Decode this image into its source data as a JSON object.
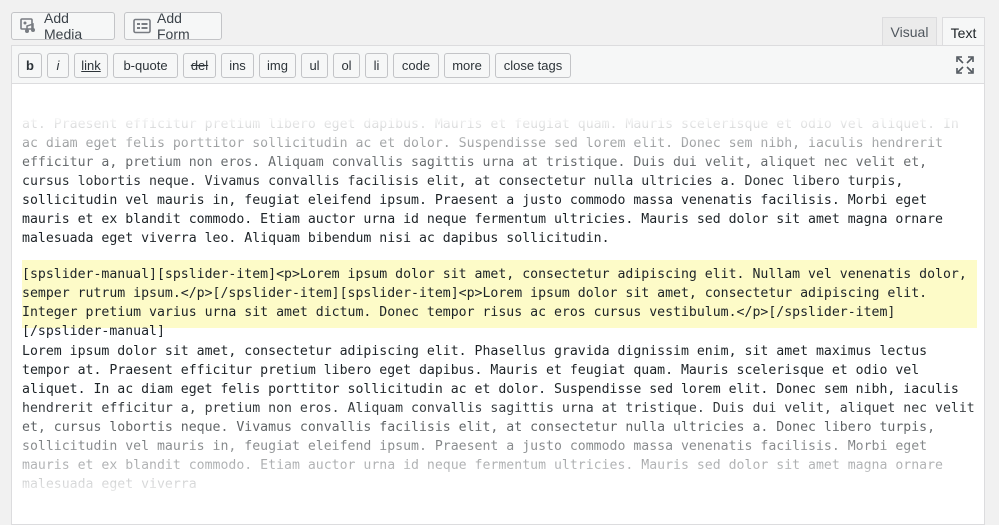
{
  "media_buttons": {
    "add_media": "Add Media",
    "add_form": "Add Form"
  },
  "tabs": {
    "visual": "Visual",
    "text": "Text",
    "active": "Text"
  },
  "quicktags": [
    "b",
    "i",
    "link",
    "b-quote",
    "del",
    "ins",
    "img",
    "ul",
    "ol",
    "li",
    "code",
    "more",
    "close tags"
  ],
  "content": {
    "para1": "at. Praesent efficitur pretium libero eget dapibus. Mauris et feugiat quam. Mauris scelerisque et odio vel aliquet. In ac diam eget felis porttitor sollicitudin ac et dolor. Suspendisse sed lorem elit. Donec sem nibh, iaculis hendrerit efficitur a, pretium non eros. Aliquam convallis sagittis urna at tristique. Duis dui velit, aliquet nec velit et, cursus lobortis neque. Vivamus convallis facilisis elit, at consectetur nulla ultricies a. Donec libero turpis, sollicitudin vel mauris in, feugiat eleifend ipsum. Praesent a justo commodo massa venenatis facilisis. Morbi eget mauris et ex blandit commodo. Etiam auctor urna id neque fermentum ultricies. Mauris sed dolor sit amet magna ornare malesuada eget viverra leo. Aliquam bibendum nisi ac dapibus sollicitudin.",
    "shortcode": "[spslider-manual][spslider-item]<p>Lorem ipsum dolor sit amet, consectetur adipiscing elit. Nullam vel venenatis dolor, semper rutrum ipsum.</p>[/spslider-item][spslider-item]<p>Lorem ipsum dolor sit amet, consectetur adipiscing elit. Integer pretium varius urna sit amet dictum. Donec tempor risus ac eros cursus vestibulum.</p>[/spslider-item][/spslider-manual]",
    "para3": "Lorem ipsum dolor sit amet, consectetur adipiscing elit. Phasellus gravida dignissim enim, sit amet maximus lectus tempor at. Praesent efficitur pretium libero eget dapibus. Mauris et feugiat quam. Mauris scelerisque et odio vel aliquet. In ac diam eget felis porttitor sollicitudin ac et dolor. Suspendisse sed lorem elit. Donec sem nibh, iaculis hendrerit efficitur a, pretium non eros. Aliquam convallis sagittis urna at tristique. Duis dui velit, aliquet nec velit et, cursus lobortis neque. Vivamus convallis facilisis elit, at consectetur nulla ultricies a. Donec libero turpis, sollicitudin vel mauris in, feugiat eleifend ipsum. Praesent a justo commodo massa venenatis facilisis. Morbi eget mauris et ex blandit commodo. Etiam auctor urna id neque fermentum ultricies. Mauris sed dolor sit amet magna ornare malesuada eget viverra"
  },
  "colors": {
    "highlight": "#fdfbc8",
    "toolbar_bg": "#f6f7f7",
    "border": "#dcdcde"
  }
}
